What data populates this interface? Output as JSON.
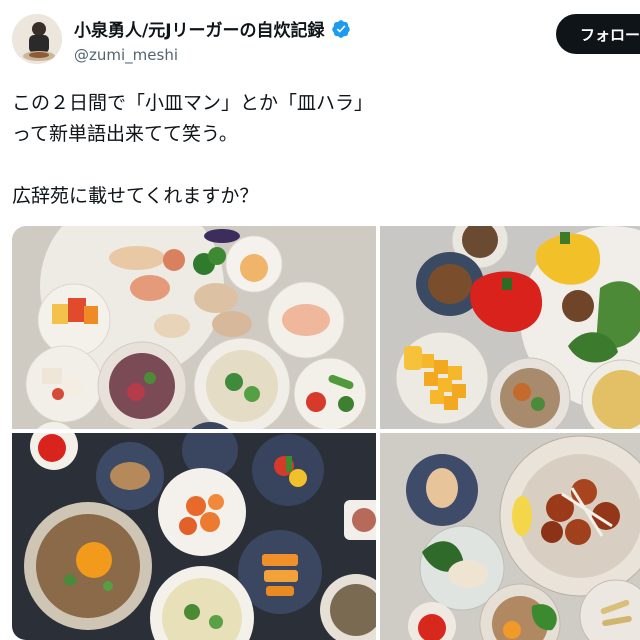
{
  "author": {
    "name": "小泉勇人/元Jリーガーの自炊記録",
    "handle": "@zumi_meshi",
    "verified": true,
    "follow_label": "フォロー"
  },
  "tweet": {
    "line1": "この２日間で「小皿マン」とか「皿ハラ」",
    "line2": "って新単語出来てて笑う。",
    "line3": "広辞苑に載せてくれますか？"
  },
  "media": {
    "photo_count": 4
  },
  "colors": {
    "verified_blue": "#1d9bf0",
    "follow_bg": "#0f1419",
    "handle_gray": "#536471"
  }
}
